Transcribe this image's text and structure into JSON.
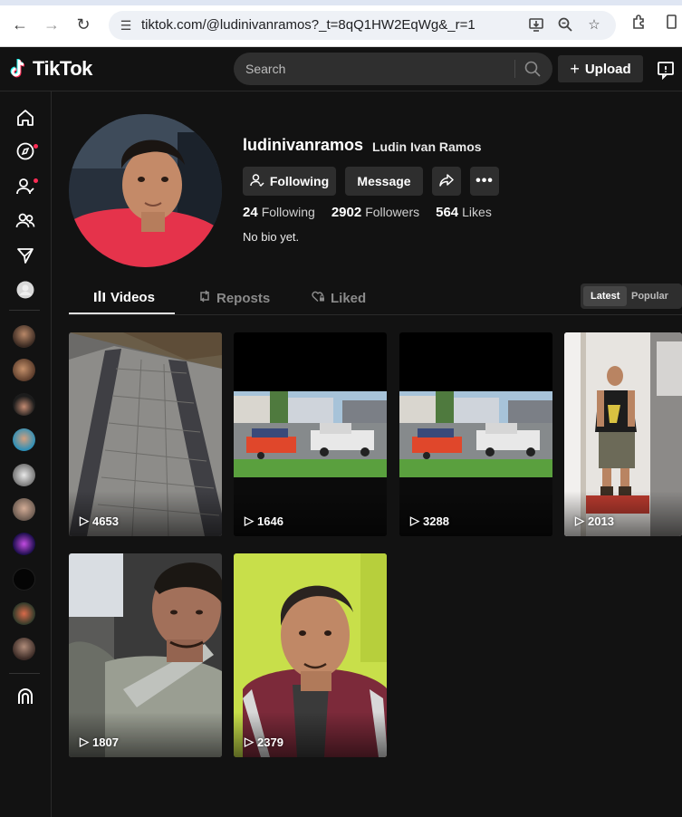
{
  "browser": {
    "url": "tiktok.com/@ludinivanramos?_t=8qQ1HW2EqWg&_r=1"
  },
  "header": {
    "logo_text": "TikTok",
    "search_placeholder": "Search",
    "upload_label": "Upload"
  },
  "profile": {
    "username": "ludinivanramos",
    "nickname": "Ludin Ivan Ramos",
    "following_button": "Following",
    "message_button": "Message",
    "stats": {
      "following_count": "24",
      "following_label": "Following",
      "followers_count": "2902",
      "followers_label": "Followers",
      "likes_count": "564",
      "likes_label": "Likes"
    },
    "bio": "No bio yet."
  },
  "tabs": [
    {
      "label": "Videos"
    },
    {
      "label": "Reposts"
    },
    {
      "label": "Liked"
    }
  ],
  "sort": {
    "latest": "Latest",
    "popular": "Popular"
  },
  "videos": [
    {
      "views": "4653"
    },
    {
      "views": "1646"
    },
    {
      "views": "3288"
    },
    {
      "views": "2013"
    },
    {
      "views": "1807"
    },
    {
      "views": "2379"
    }
  ],
  "colors": {
    "accent": "#fe2c55",
    "background": "#121212",
    "button": "#2e2e2e"
  }
}
